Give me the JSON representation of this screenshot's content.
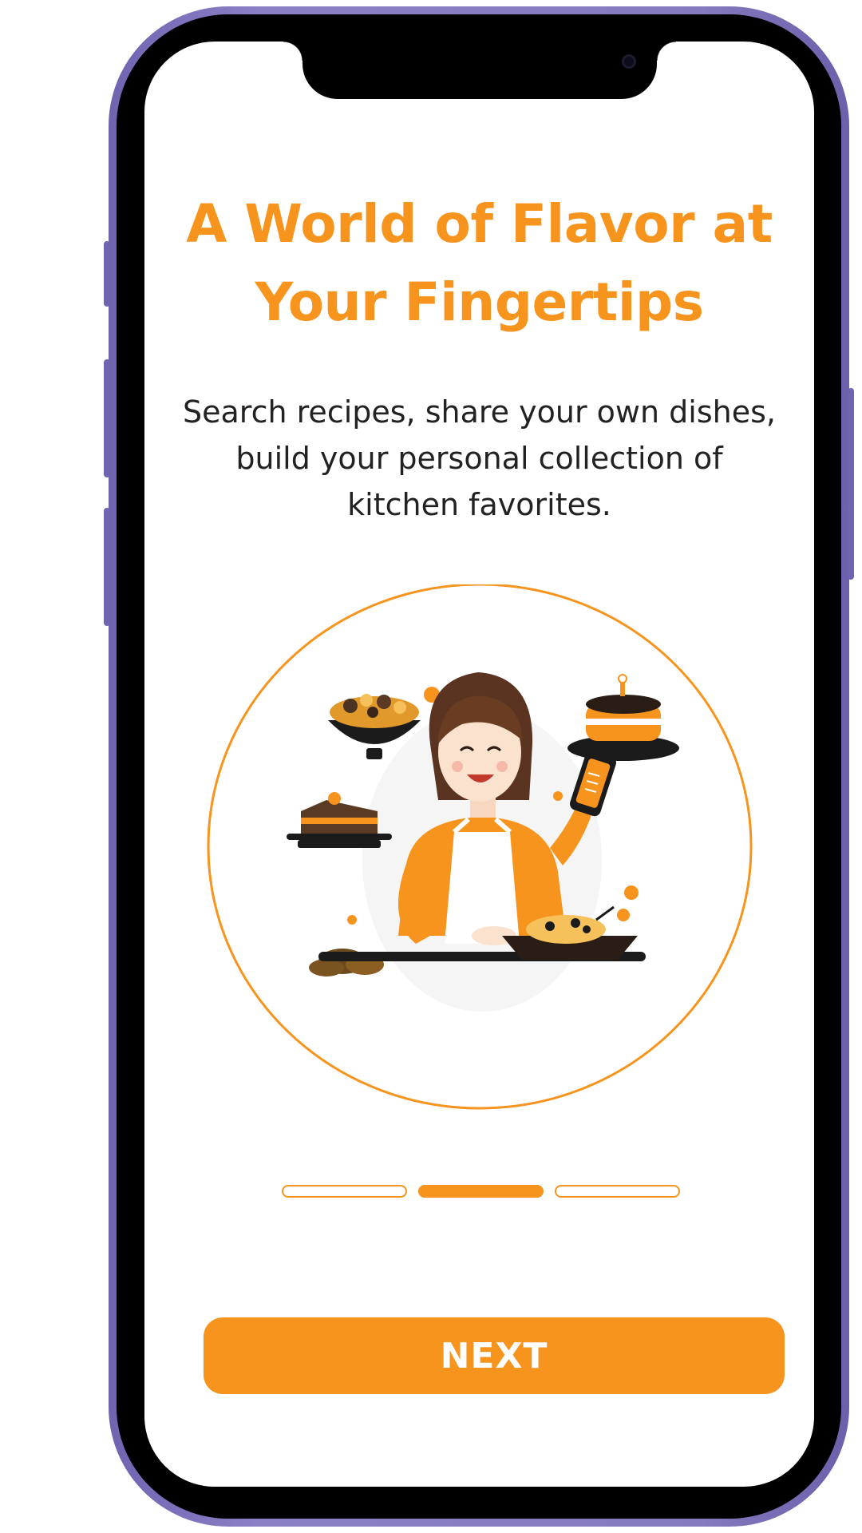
{
  "onboarding": {
    "title": "A World of Flavor at Your Fingertips",
    "description": "Search recipes, share your own dishes, build your personal collection of kitchen favorites.",
    "next_label": "NEXT",
    "page_indicator": {
      "total": 3,
      "current": 2
    },
    "illustration": "woman-cooking-with-phone-illustration"
  },
  "colors": {
    "accent": "#f7941d",
    "text": "#222222",
    "frame": "#857abf",
    "background": "#ffffff"
  }
}
